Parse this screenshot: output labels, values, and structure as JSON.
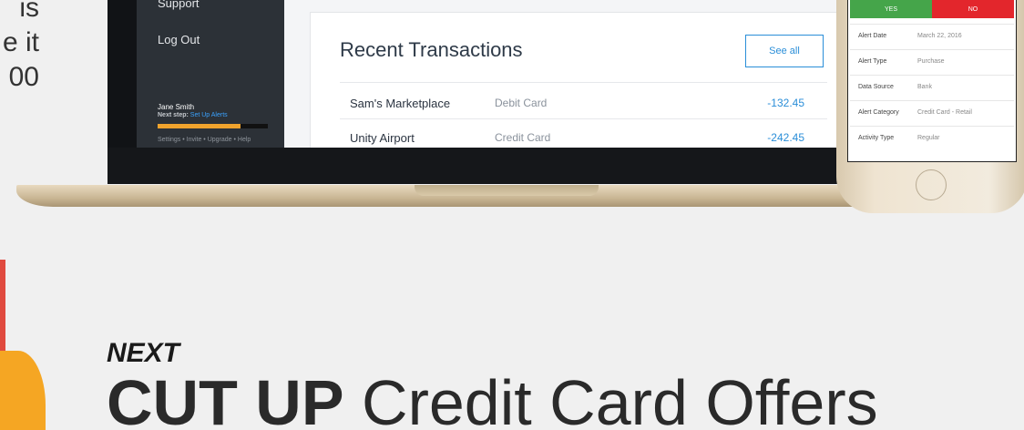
{
  "left_text": [
    "is",
    "e it",
    "00"
  ],
  "sidebar": {
    "nav": [
      "Support",
      "Log Out"
    ],
    "user_name": "Jane Smith",
    "next_step_label": "Next step:",
    "next_step_link": "Set Up Alerts",
    "progress": 0.75,
    "footer_links": "Settings • Invite • Upgrade • Help"
  },
  "transactions": {
    "title": "Recent Transactions",
    "see_all_label": "See all",
    "rows": [
      {
        "merchant": "Sam's Marketplace",
        "type": "Debit Card",
        "amount": "-132.45"
      },
      {
        "merchant": "Unity Airport",
        "type": "Credit Card",
        "amount": "-242.45"
      }
    ]
  },
  "phone": {
    "yes_label": "YES",
    "no_label": "NO",
    "details": [
      {
        "label": "Alert Date",
        "value": "March 22, 2016"
      },
      {
        "label": "Alert Type",
        "value": "Purchase"
      },
      {
        "label": "Data Source",
        "value": "Bank"
      },
      {
        "label": "Alert Category",
        "value": "Credit Card - Retail"
      },
      {
        "label": "Activity Type",
        "value": "Regular"
      }
    ]
  },
  "promo": {
    "next_label": "NEXT",
    "headline_strong": "CUT UP",
    "headline_rest": " Credit Card Offers"
  },
  "colors": {
    "accent_blue": "#2a8ed8",
    "yes_green": "#45a54a",
    "no_red": "#e3262c",
    "progress_orange": "#f0a32d",
    "sidebar_bg": "#2c3137"
  }
}
